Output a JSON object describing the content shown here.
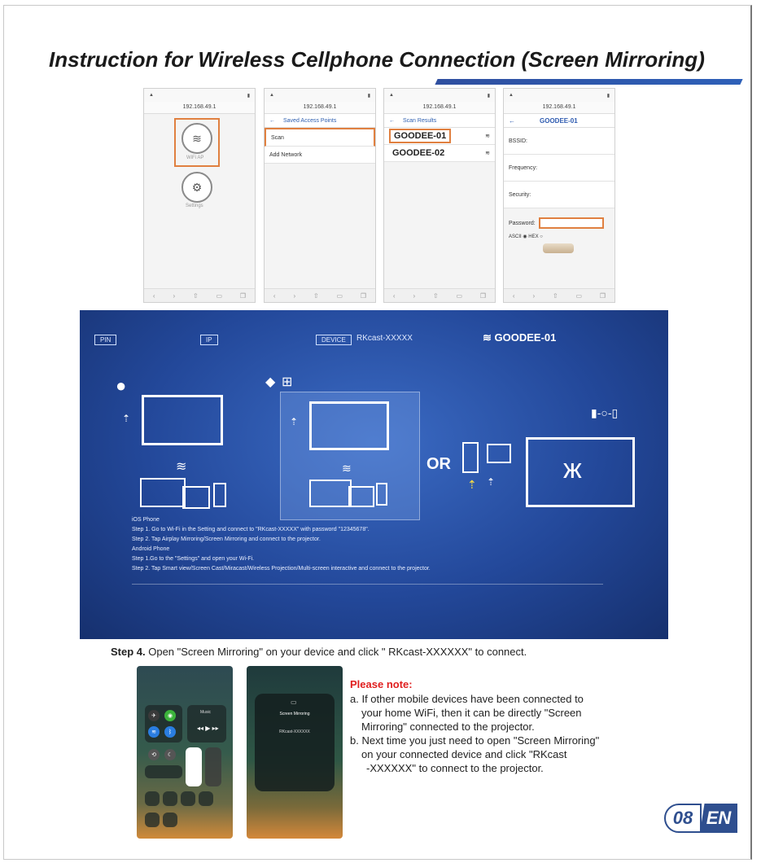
{
  "title": "Instruction for Wireless Cellphone Connection (Screen Mirroring)",
  "phones": {
    "ip1": "192.168.49.1",
    "ip4": "192.168.49.1",
    "phone1": {
      "wifi_label": "WiFi AP",
      "settings_label": "Settings"
    },
    "phone2": {
      "nav_title": "Saved Access Points",
      "items": [
        "Scan",
        "Add Network"
      ]
    },
    "phone3": {
      "nav_title": "Scan Results",
      "networks": [
        "GOODEE-01",
        "GOODEE-02"
      ]
    },
    "phone4": {
      "nav_title": "GOODEE-01",
      "fields": [
        "BSSID:",
        "Frequency:",
        "Security:"
      ],
      "password_label": "Password:",
      "ascii_label": "ASCII",
      "hex_label": "HEX"
    }
  },
  "projector": {
    "pin_tag": "PIN",
    "ip_tag": "IP",
    "device_tag": "DEVICE",
    "device_name": "RKcast-XXXXX",
    "wifi_name": "GOODEE-01",
    "or_label": "OR",
    "instructions": [
      "iOS Phone",
      "Step 1. Go to Wi-Fi in the Setting and connect to \"RKcast-XXXXX\" with password \"12345678\".",
      "Step 2. Tap Airplay Mirroring/Screen Mirroring and connect to the projector.",
      "Android Phone",
      "Step 1.Go to the \"Settings\" and open your Wi-Fi.",
      "Step 2. Tap Smart view/Screen Cast/Miracast/Wireless Projection/Multi-screen interactive and connect to the projector."
    ]
  },
  "step4": {
    "label": "Step 4.",
    "text": " Open \"Screen Mirroring\" on your device and click \" RKcast-XXXXXX\" to connect."
  },
  "control_center": {
    "music_label": "Music",
    "mirroring_title": "Screen Mirroring",
    "mirroring_device": "RKcast-XXXXXX"
  },
  "note": {
    "title": "Please note:",
    "a_line1": "a. If other mobile devices have been connected to",
    "a_line2": "your home WiFi, then it can be directly \"Screen",
    "a_line3": "Mirroring\" connected to the projector.",
    "b_line1": "b. Next time you just need to open \"Screen Mirroring\"",
    "b_line2": "on your connected device and click \"RKcast",
    "b_line3": "-XXXXXX\" to connect to the projector."
  },
  "badge": {
    "page_number": "08",
    "language": "EN"
  },
  "colors": {
    "accent_blue": "#2f4f8f",
    "highlight_orange": "#e08040",
    "note_red": "#e02020"
  }
}
